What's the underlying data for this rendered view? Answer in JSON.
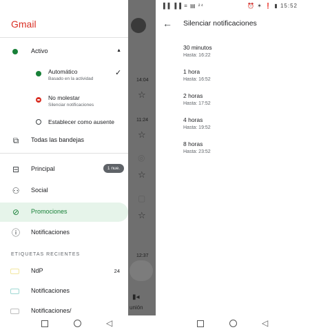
{
  "status_bar": {
    "signal_left": "▐▐ ▐▐ ≡ ▤ ²⁴",
    "time": "15:52",
    "right_icons": "⏰ ✶ ❗ ▮"
  },
  "drawer": {
    "app_title": "Gmail",
    "account_status": {
      "label": "Activo",
      "color": "#188038"
    },
    "status_options": [
      {
        "label": "Automático",
        "sublabel": "Basado en la actividad",
        "dot_color": "#188038",
        "selected": true
      },
      {
        "label": "No molestar",
        "sublabel": "Silenciar notificaciones",
        "dot_color": "#d93025",
        "selected": false
      },
      {
        "label": "Establecer como ausente",
        "sublabel": "",
        "dot_color": "#ffffff",
        "selected": false
      }
    ],
    "all_inboxes": "Todas las bandejas",
    "categories": [
      {
        "label": "Principal",
        "icon": "inbox-icon",
        "badge": "1 nue."
      },
      {
        "label": "Social",
        "icon": "people-icon"
      },
      {
        "label": "Promociones",
        "icon": "tag-icon",
        "selected": true
      },
      {
        "label": "Notificaciones",
        "icon": "info-icon"
      }
    ],
    "recent_labels_header": "ETIQUETAS RECIENTES",
    "recent_labels": [
      {
        "label": "NdP",
        "count": "24",
        "color": "#f2e7a0"
      },
      {
        "label": "Notificaciones",
        "color": "#9fd8d3"
      },
      {
        "label": "Notificaciones/",
        "color": "#bdbdbd"
      }
    ],
    "accent_color": "#188038"
  },
  "behind_inbox": {
    "times": [
      "14:04",
      "11:24",
      "12:37"
    ],
    "bottom_tab": "unión"
  },
  "mute_screen": {
    "title": "Silenciar notificaciones",
    "options": [
      {
        "label": "30 minutos",
        "until": "Hasta: 16:22"
      },
      {
        "label": "1 hora",
        "until": "Hasta: 16:52"
      },
      {
        "label": "2 horas",
        "until": "Hasta: 17:52"
      },
      {
        "label": "4 horas",
        "until": "Hasta: 19:52"
      },
      {
        "label": "8 horas",
        "until": "Hasta: 23:52"
      }
    ]
  }
}
